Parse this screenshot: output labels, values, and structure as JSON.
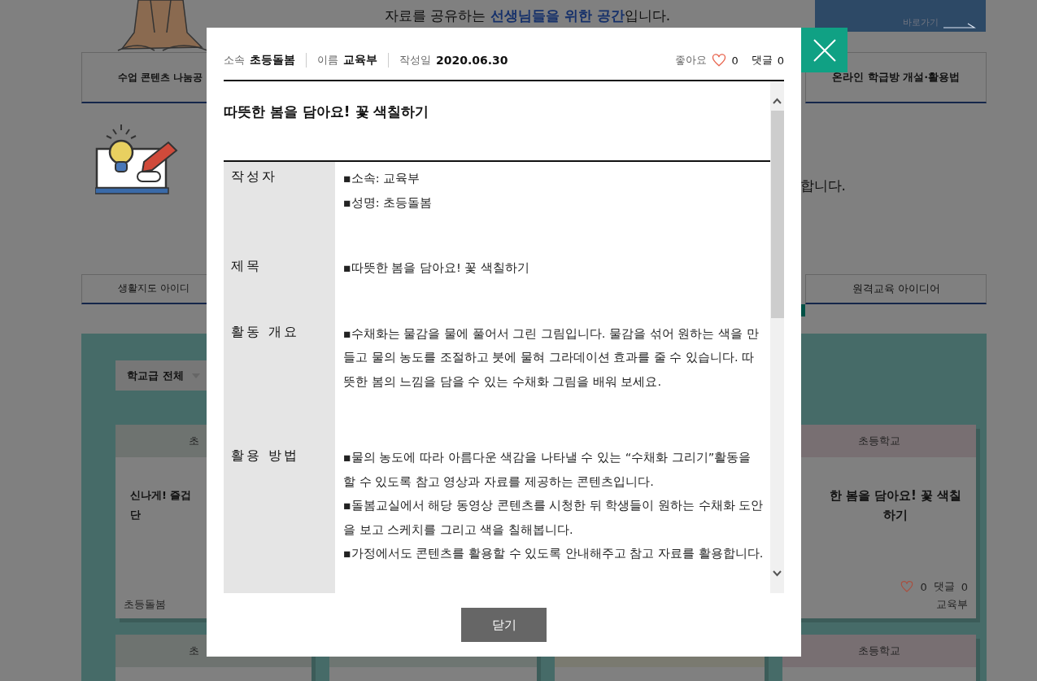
{
  "header": {
    "intro": "자료를 공유하는 **선생님들을 위한 공간**입니다.",
    "banner_link": "바로가기"
  },
  "top_tabs": [
    {
      "label": "수업 콘텐츠 나눔공"
    },
    {
      "label": "온라인 학급방 개설·활용법"
    }
  ],
  "info_fragment": "합니다.",
  "idea_tabs": [
    {
      "label": "생활지도 아이디"
    },
    {
      "label": "원격교육 아이디어"
    }
  ],
  "filter": {
    "value": "학교급 전체"
  },
  "cards": [
    {
      "category": "초",
      "color": "#6e7370",
      "title_lines": [
        "신나게! 즐겁",
        "단"
      ],
      "author_group": "초등돌봄"
    },
    {
      "category": "초등학교",
      "color": "#786f72",
      "title_lines": [
        "한 봄을 담아요! 꽃 색칠",
        "하기"
      ],
      "likes": "0",
      "comments_label": "댓글",
      "comments": "0",
      "author": "교육부"
    },
    {
      "category": "초",
      "color": "#6e7370"
    },
    {
      "color": "#6e7672"
    },
    {
      "color": "#7a7a70"
    },
    {
      "category": "초등학교",
      "color": "#786f72"
    }
  ],
  "modal": {
    "meta": [
      {
        "label": "소속",
        "value": "초등돌봄"
      },
      {
        "label": "이름",
        "value": "교육부"
      },
      {
        "label": "작성일",
        "value": "2020.06.30"
      }
    ],
    "likes": {
      "label": "좋아요",
      "count": "0"
    },
    "comments": {
      "label": "댓글",
      "count": "0"
    },
    "title": "따뜻한 봄을 담아요! 꽃 색칠하기",
    "rows": [
      {
        "label": "작성자",
        "lines": [
          "▪소속: 교육부",
          "▪성명: 초등돌봄"
        ]
      },
      {
        "label": "제목",
        "lines": [
          "▪따뜻한 봄을 담아요! 꽃 색칠하기"
        ]
      },
      {
        "label": "활동 개요",
        "lines": [
          "▪수채화는 물감을 물에 풀어서 그린 그림입니다. 물감을 섞어 원하는 색을 만들고 물의 농도를 조절하고 붓에 물혀 그라데이션 효과를 줄 수 있습니다. 따뜻한 봄의 느낌을 담을 수 있는 수채화 그림을 배워 보세요."
        ]
      },
      {
        "label": "활용 방법",
        "lines": [
          "▪물의 농도에 따라 아름다운 색감을 나타낼 수 있는 “수채화 그리기”활동을 할 수 있도록 참고 영상과 자료를 제공하는 콘텐츠입니다.",
          "▪돌봄교실에서 해당 동영상 콘텐츠를 시청한 뒤 학생들이 원하는 수채화 도안을 보고 스케치를 그리고 색을 칠해봅니다.",
          "▪가정에서도 콘텐츠를 활용할 수 있도록 안내해주고 참고 자료를 활용합니다."
        ]
      }
    ],
    "close_button": "닫기"
  }
}
